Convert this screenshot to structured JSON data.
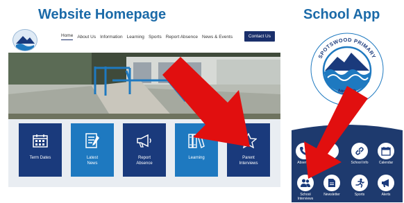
{
  "headings": {
    "website": "Website Homepage",
    "app": "School App"
  },
  "website": {
    "nav": {
      "items": [
        "Home",
        "About Us",
        "Information",
        "Learning",
        "Sports",
        "Report Absence",
        "News & Events"
      ],
      "contact": "Contact Us"
    },
    "cards": [
      {
        "label": "Term Dates",
        "icon": "calendar-icon"
      },
      {
        "label": "Latest\nNews",
        "icon": "news-icon"
      },
      {
        "label": "Report\nAbsence",
        "icon": "megaphone-icon"
      },
      {
        "label": "Learning",
        "icon": "books-icon"
      },
      {
        "label": "Parent\nInterviews",
        "icon": "star-icon"
      }
    ]
  },
  "app": {
    "logo_top": "SPOTSWOOD PRIMARY",
    "logo_bottom": "ME AKO",
    "icons_row1": [
      {
        "label": "Absence",
        "icon": "phone-icon"
      },
      {
        "label": "",
        "icon": "blank"
      },
      {
        "label": "School Info",
        "icon": "link-icon"
      },
      {
        "label": "Calendar",
        "icon": "calendar-icon"
      }
    ],
    "icons_row2": [
      {
        "label": "School\nInterviews",
        "icon": "people-icon"
      },
      {
        "label": "Newsletter",
        "icon": "document-icon"
      },
      {
        "label": "Sports",
        "icon": "runner-icon"
      },
      {
        "label": "Alerts",
        "icon": "megaphone-icon"
      }
    ]
  },
  "colors": {
    "heading": "#1b6aa8",
    "navy": "#1a3a7c",
    "blue": "#1e79c0",
    "arrow": "#e10f0f"
  }
}
